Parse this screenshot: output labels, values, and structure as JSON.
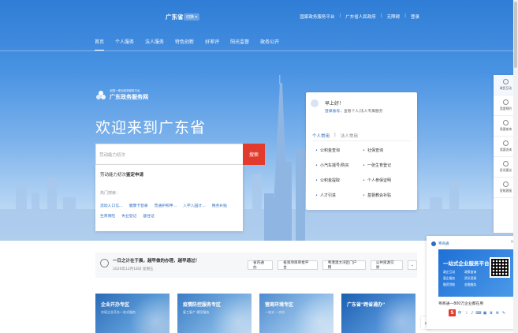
{
  "header": {
    "city": "广东省",
    "switch_label": "切换 ▾",
    "links": [
      "国家政务服务平台",
      "广东省人民政府",
      "无障碍"
    ],
    "login": "登录"
  },
  "nav": [
    "首页",
    "个人服务",
    "法人服务",
    "特色创新",
    "好差评",
    "阳光监督",
    "政务公开"
  ],
  "logo": {
    "small_text": "全国一体化政务服务平台",
    "name": "广东政务服务网"
  },
  "hero": {
    "welcome": "欢迎来到广东省"
  },
  "search": {
    "placeholder": "劳动能力初次",
    "button": "搜索",
    "suggestion_prefix": "劳动能力初次",
    "suggestion_bold": "鉴定申请",
    "hot_label": "热门搜索：",
    "hot_terms": [
      "流动人口信...",
      "健康卡登录",
      "普通护照申...",
      "入学入园计...",
      "税务补贴",
      "生育保险",
      "失业登记",
      "居住证"
    ]
  },
  "user_card": {
    "greeting": "早上好！",
    "sub_link": "登录账号",
    "sub_text": "，查看个人/法人专属服务",
    "tabs": [
      "个人常用",
      "法人常用"
    ],
    "services": [
      "公积金查询",
      "社保查询",
      "小汽车摇号/购买",
      "一张生育登记",
      "公积金提取",
      "个人参保证明",
      "人才引进",
      "基督教会补贴"
    ]
  },
  "rail": [
    "政民互动",
    "我要预约",
    "我要查询",
    "我要咨询",
    "投诉建议",
    "智能客服"
  ],
  "promo": {
    "header": "粤商通",
    "close": "×",
    "title": "一站式企业服务平台",
    "features": [
      "政企互动",
      "政策查询",
      "惠企服务",
      "资讯资源",
      "融资贷款",
      "金融服务"
    ],
    "subtitle": "粤商通—800万企业都在用",
    "toolbar_letter": "S",
    "toolbar_icons": [
      "中",
      "☽",
      "♪",
      "⌨",
      "▣",
      "♛",
      "⚙",
      "✎"
    ]
  },
  "notice": {
    "title": "一日之计在于晨，越早做的办理，越早通过！",
    "date": "2020年12月18日 星期五",
    "quick_links": [
      "省内通办",
      "投资项目审批平台",
      "粤港澳大湾区门户网",
      "公共资源交易"
    ],
    "more": "⌄"
  },
  "tiles": [
    {
      "title": "企业开办专区",
      "sub": "实现企业开办一站式服务"
    },
    {
      "title": "疫情防控服务专区",
      "sub": "复工复产 便民服务"
    },
    {
      "title": "营商环境专区",
      "sub": "一站式 一次办"
    },
    {
      "title": "广东省\"跨省通办\"",
      "sub": ""
    }
  ],
  "carousel_next": "›",
  "colors": {
    "primary": "#2b6cc4",
    "search_button": "#e23b2e",
    "hero_top": "#2f7dd6"
  }
}
